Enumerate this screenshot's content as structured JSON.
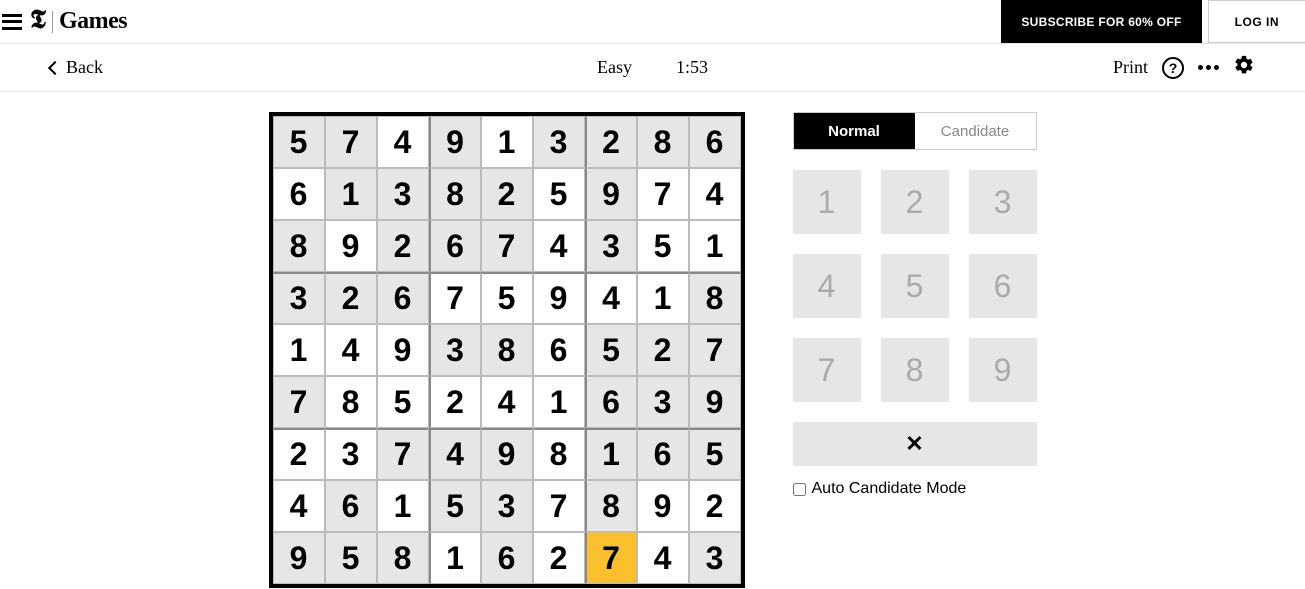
{
  "brand": {
    "logo": "𝕿",
    "label": "Games"
  },
  "header": {
    "subscribe_label": "SUBSCRIBE FOR 60% OFF",
    "login_label": "LOG IN"
  },
  "subheader": {
    "back_label": "Back",
    "difficulty": "Easy",
    "timer": "1:53",
    "print_label": "Print"
  },
  "board": {
    "selected": [
      8,
      6
    ],
    "cells": [
      [
        {
          "v": "5",
          "g": true
        },
        {
          "v": "7",
          "g": true
        },
        {
          "v": "4",
          "g": false
        },
        {
          "v": "9",
          "g": true
        },
        {
          "v": "1",
          "g": false
        },
        {
          "v": "3",
          "g": true
        },
        {
          "v": "2",
          "g": true
        },
        {
          "v": "8",
          "g": true
        },
        {
          "v": "6",
          "g": true
        }
      ],
      [
        {
          "v": "6",
          "g": false
        },
        {
          "v": "1",
          "g": true
        },
        {
          "v": "3",
          "g": true
        },
        {
          "v": "8",
          "g": true
        },
        {
          "v": "2",
          "g": true
        },
        {
          "v": "5",
          "g": false
        },
        {
          "v": "9",
          "g": true
        },
        {
          "v": "7",
          "g": false
        },
        {
          "v": "4",
          "g": false
        }
      ],
      [
        {
          "v": "8",
          "g": true
        },
        {
          "v": "9",
          "g": false
        },
        {
          "v": "2",
          "g": true
        },
        {
          "v": "6",
          "g": true
        },
        {
          "v": "7",
          "g": true
        },
        {
          "v": "4",
          "g": false
        },
        {
          "v": "3",
          "g": true
        },
        {
          "v": "5",
          "g": false
        },
        {
          "v": "1",
          "g": false
        }
      ],
      [
        {
          "v": "3",
          "g": true
        },
        {
          "v": "2",
          "g": true
        },
        {
          "v": "6",
          "g": true
        },
        {
          "v": "7",
          "g": false
        },
        {
          "v": "5",
          "g": false
        },
        {
          "v": "9",
          "g": false
        },
        {
          "v": "4",
          "g": false
        },
        {
          "v": "1",
          "g": false
        },
        {
          "v": "8",
          "g": true
        }
      ],
      [
        {
          "v": "1",
          "g": false
        },
        {
          "v": "4",
          "g": false
        },
        {
          "v": "9",
          "g": false
        },
        {
          "v": "3",
          "g": true
        },
        {
          "v": "8",
          "g": true
        },
        {
          "v": "6",
          "g": false
        },
        {
          "v": "5",
          "g": true
        },
        {
          "v": "2",
          "g": true
        },
        {
          "v": "7",
          "g": true
        }
      ],
      [
        {
          "v": "7",
          "g": true
        },
        {
          "v": "8",
          "g": false
        },
        {
          "v": "5",
          "g": false
        },
        {
          "v": "2",
          "g": false
        },
        {
          "v": "4",
          "g": false
        },
        {
          "v": "1",
          "g": false
        },
        {
          "v": "6",
          "g": true
        },
        {
          "v": "3",
          "g": true
        },
        {
          "v": "9",
          "g": true
        }
      ],
      [
        {
          "v": "2",
          "g": false
        },
        {
          "v": "3",
          "g": false
        },
        {
          "v": "7",
          "g": true
        },
        {
          "v": "4",
          "g": true
        },
        {
          "v": "9",
          "g": true
        },
        {
          "v": "8",
          "g": false
        },
        {
          "v": "1",
          "g": true
        },
        {
          "v": "6",
          "g": true
        },
        {
          "v": "5",
          "g": true
        }
      ],
      [
        {
          "v": "4",
          "g": false
        },
        {
          "v": "6",
          "g": true
        },
        {
          "v": "1",
          "g": false
        },
        {
          "v": "5",
          "g": true
        },
        {
          "v": "3",
          "g": true
        },
        {
          "v": "7",
          "g": false
        },
        {
          "v": "8",
          "g": true
        },
        {
          "v": "9",
          "g": false
        },
        {
          "v": "2",
          "g": false
        }
      ],
      [
        {
          "v": "9",
          "g": true
        },
        {
          "v": "5",
          "g": true
        },
        {
          "v": "8",
          "g": true
        },
        {
          "v": "1",
          "g": false
        },
        {
          "v": "6",
          "g": true
        },
        {
          "v": "2",
          "g": false
        },
        {
          "v": "7",
          "g": false
        },
        {
          "v": "4",
          "g": false
        },
        {
          "v": "3",
          "g": true
        }
      ]
    ]
  },
  "side": {
    "mode_normal": "Normal",
    "mode_candidate": "Candidate",
    "keys": [
      "1",
      "2",
      "3",
      "4",
      "5",
      "6",
      "7",
      "8",
      "9"
    ],
    "erase_symbol": "✕",
    "auto_candidate_label": "Auto Candidate Mode"
  }
}
